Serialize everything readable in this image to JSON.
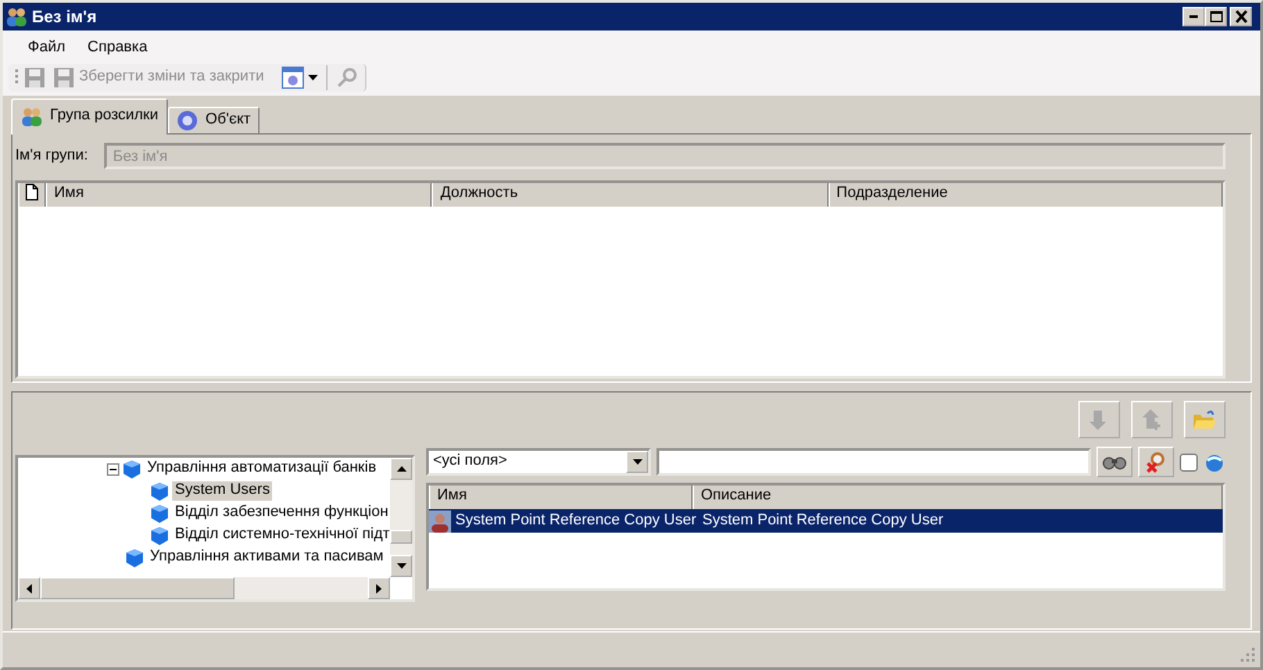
{
  "window": {
    "title": "Без ім'я"
  },
  "menu": [
    "Файл",
    "Справка"
  ],
  "toolbar": {
    "save_button": {
      "disabled": true
    },
    "save_close_button": {
      "label": "Зберегти зміни та закрити",
      "disabled": true
    },
    "menu_button": {
      "disabled": false
    },
    "key_button": {
      "disabled": true
    }
  },
  "tabs": [
    {
      "label": "Група розсилки",
      "selected": true
    },
    {
      "label": "Об'єкт",
      "selected": false
    }
  ],
  "group_name": {
    "label": "Ім'я групи:",
    "value": "Без ім'я",
    "disabled": true
  },
  "members_table": {
    "columns": [
      "Имя",
      "Должность",
      "Подразделение"
    ]
  },
  "action_buttons": [
    {
      "disabled": true
    },
    {
      "disabled": true
    },
    {
      "disabled": false
    }
  ],
  "tree": [
    {
      "label": "Управління автоматизації банків",
      "expanded": true,
      "selected": false,
      "children": [
        {
          "label": "System Users",
          "selected": true
        },
        {
          "label": "Відділ забезпечення функціон",
          "selected": false
        },
        {
          "label": "Відділ системно-технічної підт",
          "selected": false
        }
      ]
    },
    {
      "label": "Управління активами та пасивам",
      "selected": false
    }
  ],
  "search": {
    "field_selector": "<усі поля>",
    "whole_word_checked": false
  },
  "results": {
    "columns": [
      "Имя",
      "Описание"
    ],
    "rows": [
      {
        "cells": [
          "System Point Reference Copy User",
          "System Point Reference Copy User"
        ],
        "selected": true
      }
    ]
  }
}
